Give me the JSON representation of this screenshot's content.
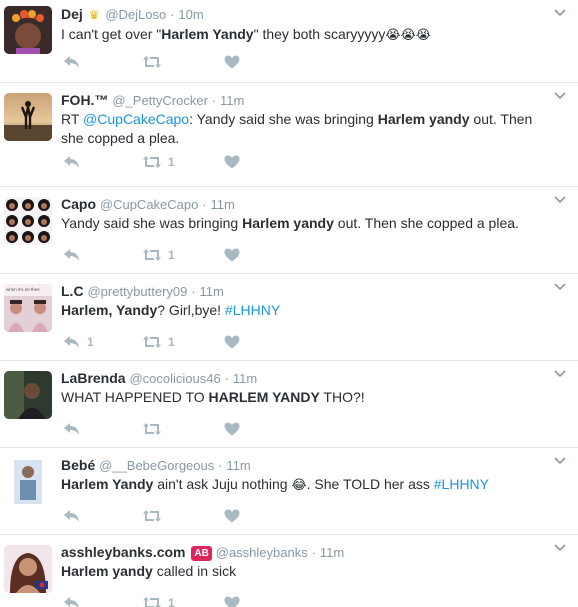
{
  "colors": {
    "link": "#1b95e0",
    "icon": "#aab8c2",
    "secondary": "#8899a6",
    "divider": "#e1e8ed"
  },
  "tweets": [
    {
      "name": "Dej",
      "handle": "@DejLoso",
      "time": "10m",
      "text_parts": [
        "I can't get over \"",
        "Harlem Yandy",
        "\" they both scaryyyyy"
      ],
      "emoji": "😭😭😭",
      "reply_count": "",
      "retweet_count": "",
      "like_count": ""
    },
    {
      "name": "FOH.™",
      "handle": "@_PettyCrocker",
      "time": "11m",
      "text_parts": [
        "RT ",
        "@CupCakeCapo",
        ": Yandy said she was bringing ",
        "Harlem yandy",
        " out. Then she copped a plea."
      ],
      "reply_count": "",
      "retweet_count": "1",
      "like_count": ""
    },
    {
      "name": "Capo",
      "handle": "@CupCakeCapo",
      "time": "11m",
      "text_parts": [
        "Yandy said she was bringing ",
        "Harlem yandy",
        " out. Then she copped a plea."
      ],
      "reply_count": "",
      "retweet_count": "1",
      "like_count": ""
    },
    {
      "name": "L.C",
      "handle": "@prettybuttery09",
      "time": "11m",
      "text_parts": [
        "Harlem, Yandy",
        "? Girl,bye! ",
        "#LHHNY"
      ],
      "reply_count": "1",
      "retweet_count": "1",
      "like_count": ""
    },
    {
      "name": "LaBrenda",
      "handle": "@cocolicious46",
      "time": "11m",
      "text_parts": [
        "WHAT HAPPENED TO ",
        "HARLEM YANDY",
        " THO?!"
      ],
      "reply_count": "",
      "retweet_count": "",
      "like_count": ""
    },
    {
      "name": "Bebé",
      "handle": "@__BebeGorgeous",
      "time": "11m",
      "text_parts": [
        "Harlem Yandy",
        " ain't ask Juju nothing ",
        ". She TOLD her ass ",
        "#LHHNY"
      ],
      "emoji": "😂",
      "reply_count": "",
      "retweet_count": "",
      "like_count": ""
    },
    {
      "name": "asshleybanks.com",
      "badge": "AB",
      "handle": "@asshleybanks",
      "time": "11m",
      "text_parts": [
        "Harlem yandy",
        " called in sick"
      ],
      "reply_count": "",
      "retweet_count": "1",
      "like_count": ""
    }
  ],
  "separator": "·",
  "avatar_caption": "when it's on thee"
}
